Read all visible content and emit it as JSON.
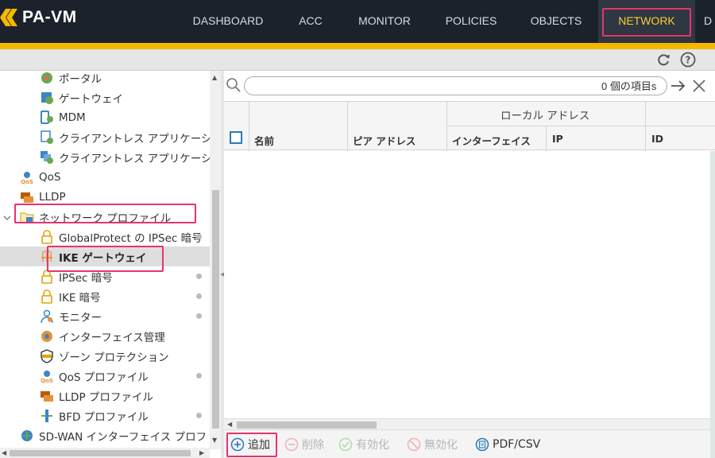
{
  "app": {
    "logo_text": "PA-VM",
    "brand_color": "#f5b800",
    "nav_background": "#1b222c",
    "highlight_color": "#e8336e"
  },
  "nav": {
    "items": [
      {
        "label": "DASHBOARD",
        "active": false
      },
      {
        "label": "ACC",
        "active": false
      },
      {
        "label": "MONITOR",
        "active": false
      },
      {
        "label": "POLICIES",
        "active": false
      },
      {
        "label": "OBJECTS",
        "active": false
      },
      {
        "label": "NETWORK",
        "active": true
      },
      {
        "label": "D",
        "active": false
      }
    ]
  },
  "toolbar": {
    "refresh_icon": "refresh-icon",
    "help_icon": "help-icon"
  },
  "tree": {
    "items": [
      {
        "label": "ポータル",
        "icon": "portal-icon",
        "level": 2,
        "dot": false
      },
      {
        "label": "ゲートウェイ",
        "icon": "gateway-icon",
        "level": 2,
        "dot": false
      },
      {
        "label": "MDM",
        "icon": "mdm-icon",
        "level": 2,
        "dot": false
      },
      {
        "label": "クライアントレス アプリケーシ",
        "icon": "clientless-app-icon",
        "level": 2,
        "dot": false
      },
      {
        "label": "クライアントレス アプリケーシ",
        "icon": "clientless-app-group-icon",
        "level": 2,
        "dot": false
      },
      {
        "label": "QoS",
        "icon": "qos-icon",
        "level": 1,
        "dot": false
      },
      {
        "label": "LLDP",
        "icon": "lldp-icon",
        "level": 1,
        "dot": false
      },
      {
        "label": "ネットワーク プロファイル",
        "icon": "folder-icon",
        "level": 1,
        "dot": false,
        "expanded": true
      },
      {
        "label": "GlobalProtect の IPSec 暗号",
        "icon": "lock-icon",
        "level": 2,
        "dot": true
      },
      {
        "label": "IKE ゲートウェイ",
        "icon": "ike-gateway-icon",
        "level": 2,
        "dot": false,
        "selected": true
      },
      {
        "label": "IPSec 暗号",
        "icon": "lock-icon",
        "level": 2,
        "dot": true
      },
      {
        "label": "IKE 暗号",
        "icon": "lock-icon",
        "level": 2,
        "dot": true
      },
      {
        "label": "モニター",
        "icon": "monitor-icon",
        "level": 2,
        "dot": true
      },
      {
        "label": "インターフェイス管理",
        "icon": "interface-mgmt-icon",
        "level": 2,
        "dot": false
      },
      {
        "label": "ゾーン プロテクション",
        "icon": "zone-protection-icon",
        "level": 2,
        "dot": false
      },
      {
        "label": "QoS プロファイル",
        "icon": "qos-icon",
        "level": 2,
        "dot": true
      },
      {
        "label": "LLDP プロファイル",
        "icon": "lldp-icon",
        "level": 2,
        "dot": false
      },
      {
        "label": "BFD プロファイル",
        "icon": "bfd-icon",
        "level": 2,
        "dot": true
      },
      {
        "label": "SD-WAN インターフェイス プロフ",
        "icon": "sdwan-icon",
        "level": 1,
        "dot": false
      }
    ]
  },
  "search": {
    "value": "",
    "placeholder": "",
    "result_count": "0 個の項目s"
  },
  "grid": {
    "group_header": "ローカル アドレス",
    "columns": [
      "名前",
      "ピア アドレス",
      "インターフェイス",
      "IP",
      "ID"
    ],
    "rows": []
  },
  "actions": [
    {
      "label": "追加",
      "enabled": true,
      "icon": "add-icon"
    },
    {
      "label": "削除",
      "enabled": false,
      "icon": "delete-icon"
    },
    {
      "label": "有効化",
      "enabled": false,
      "icon": "enable-icon"
    },
    {
      "label": "無効化",
      "enabled": false,
      "icon": "disable-icon"
    },
    {
      "label": "PDF/CSV",
      "enabled": true,
      "icon": "pdf-csv-icon"
    }
  ]
}
